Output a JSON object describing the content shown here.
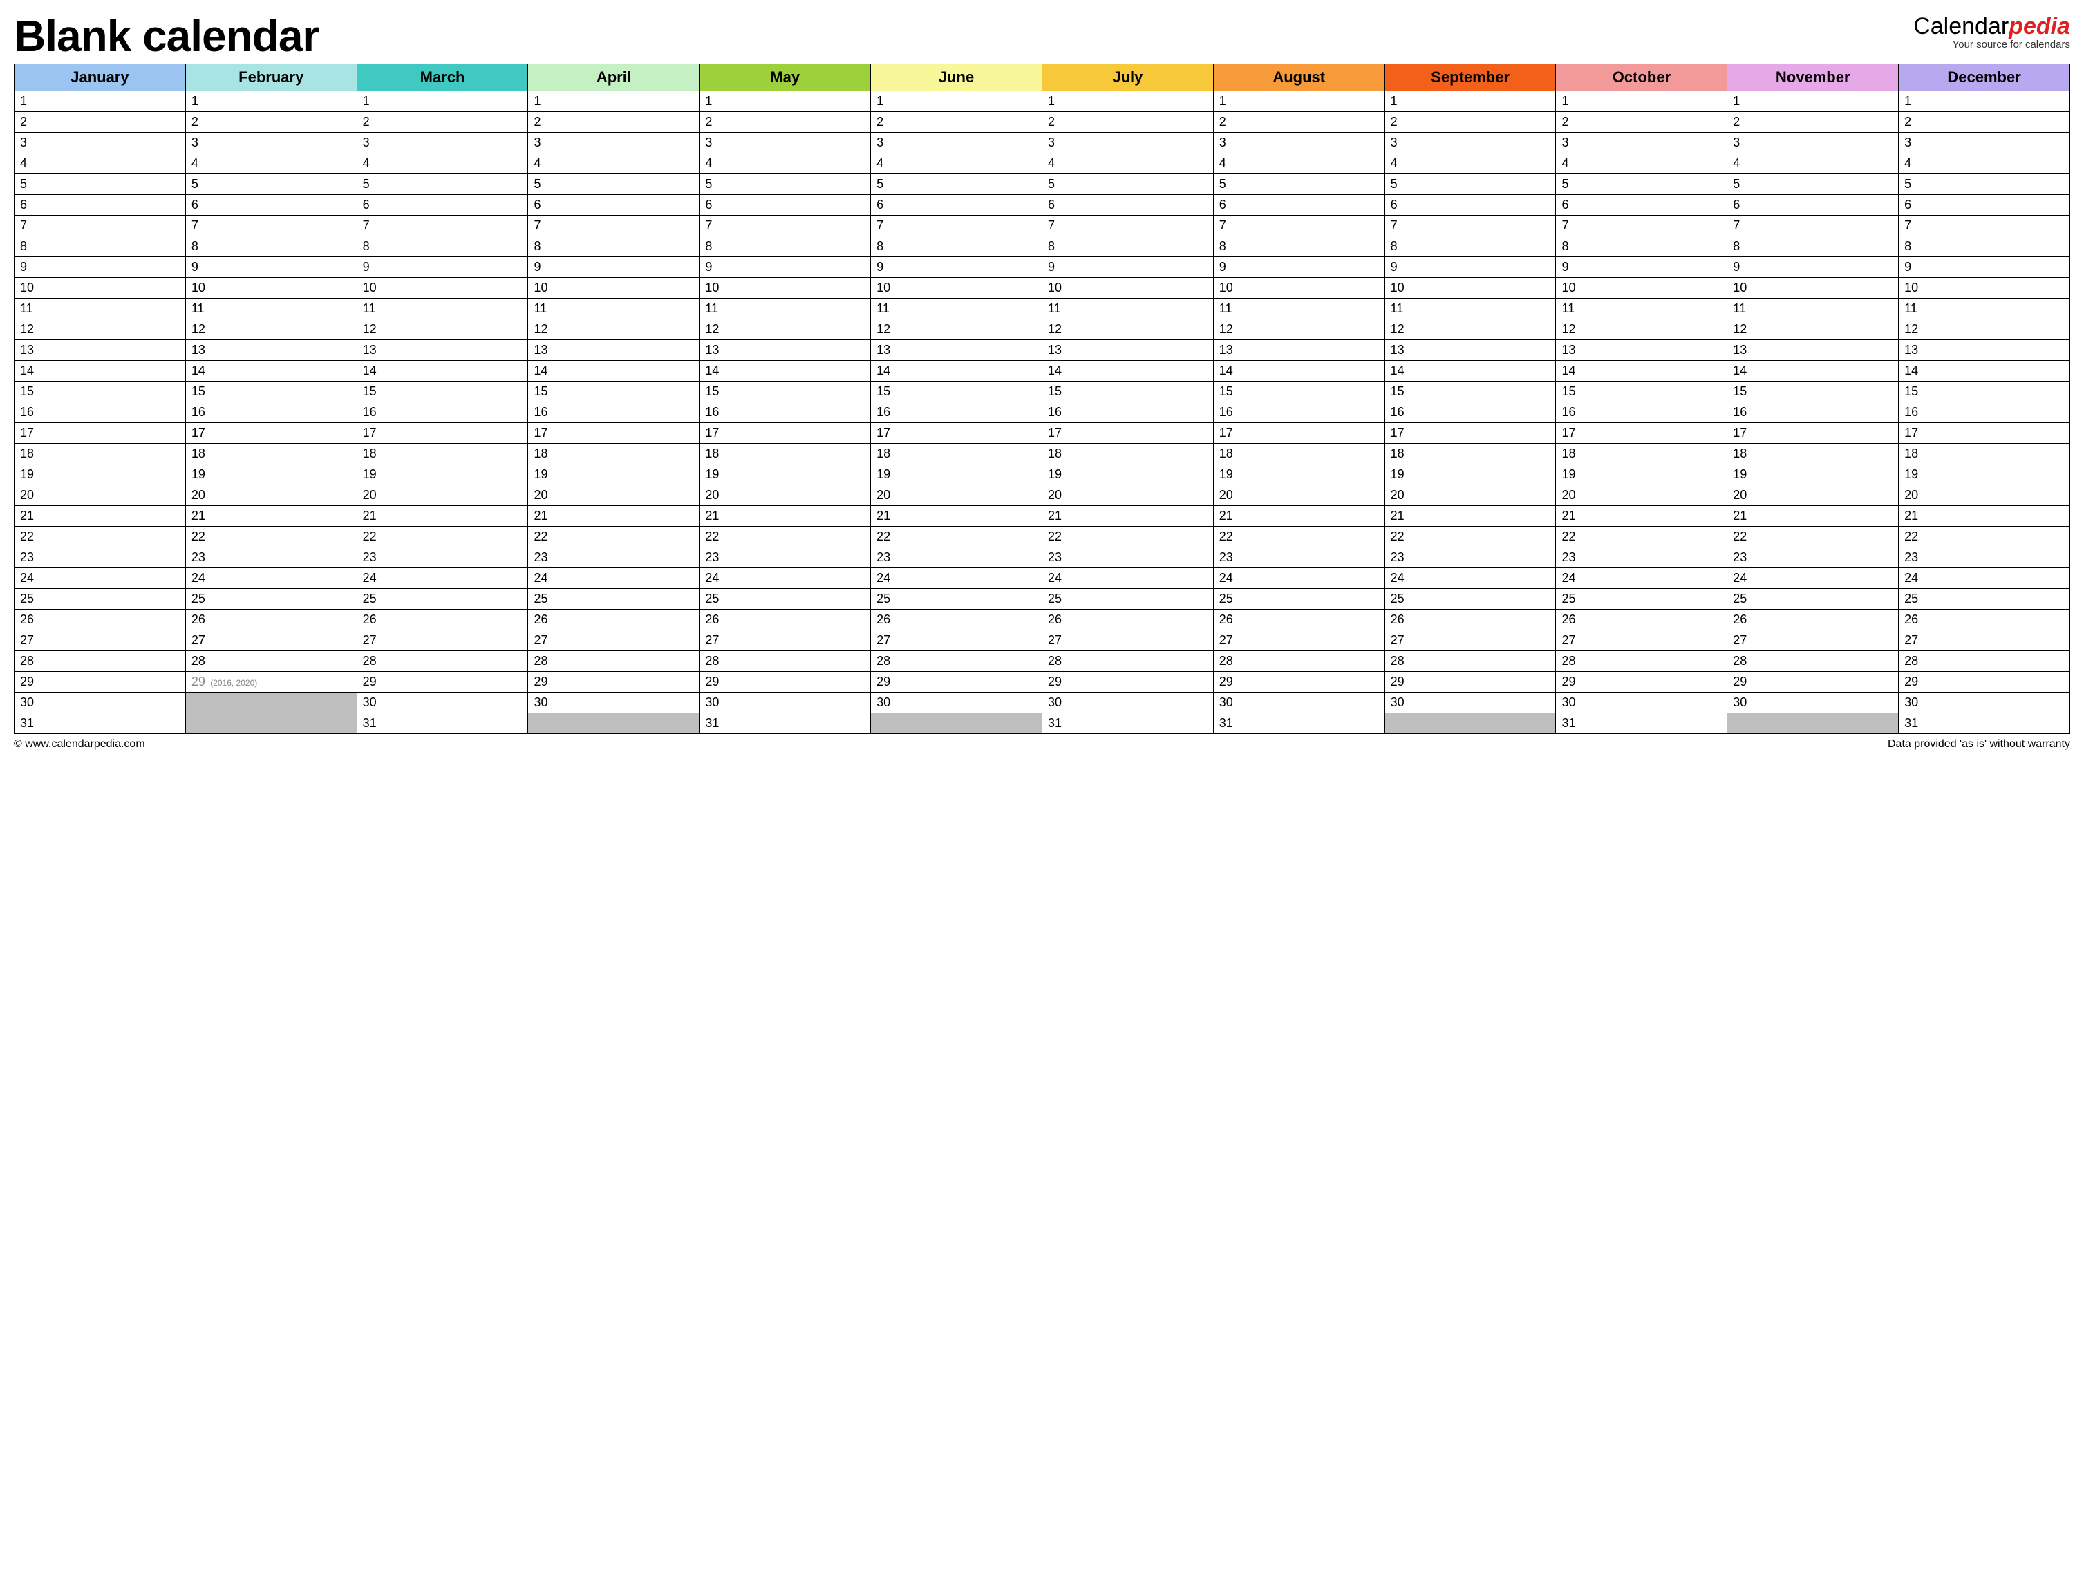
{
  "header": {
    "title": "Blank calendar",
    "brand_main": "Calendar",
    "brand_suffix": "pedia",
    "brand_tagline": "Your source for calendars"
  },
  "months": [
    {
      "name": "January",
      "color": "#9bc4f0",
      "days": 31
    },
    {
      "name": "February",
      "color": "#a8e4e3",
      "days": 28,
      "leap_day": 29,
      "leap_note": "(2016, 2020)"
    },
    {
      "name": "March",
      "color": "#3fc9c1",
      "days": 31
    },
    {
      "name": "April",
      "color": "#c4f0c4",
      "days": 30
    },
    {
      "name": "May",
      "color": "#9dd03a",
      "days": 31
    },
    {
      "name": "June",
      "color": "#f7f79a",
      "days": 30
    },
    {
      "name": "July",
      "color": "#f7c93a",
      "days": 31
    },
    {
      "name": "August",
      "color": "#f79a3a",
      "days": 31
    },
    {
      "name": "September",
      "color": "#f2601a",
      "days": 30
    },
    {
      "name": "October",
      "color": "#f29a9a",
      "days": 31
    },
    {
      "name": "November",
      "color": "#e6a8e6",
      "days": 30
    },
    {
      "name": "December",
      "color": "#b8a8f0",
      "days": 31
    }
  ],
  "max_rows": 31,
  "footer": {
    "left": "© www.calendarpedia.com",
    "right": "Data provided 'as is' without warranty"
  }
}
